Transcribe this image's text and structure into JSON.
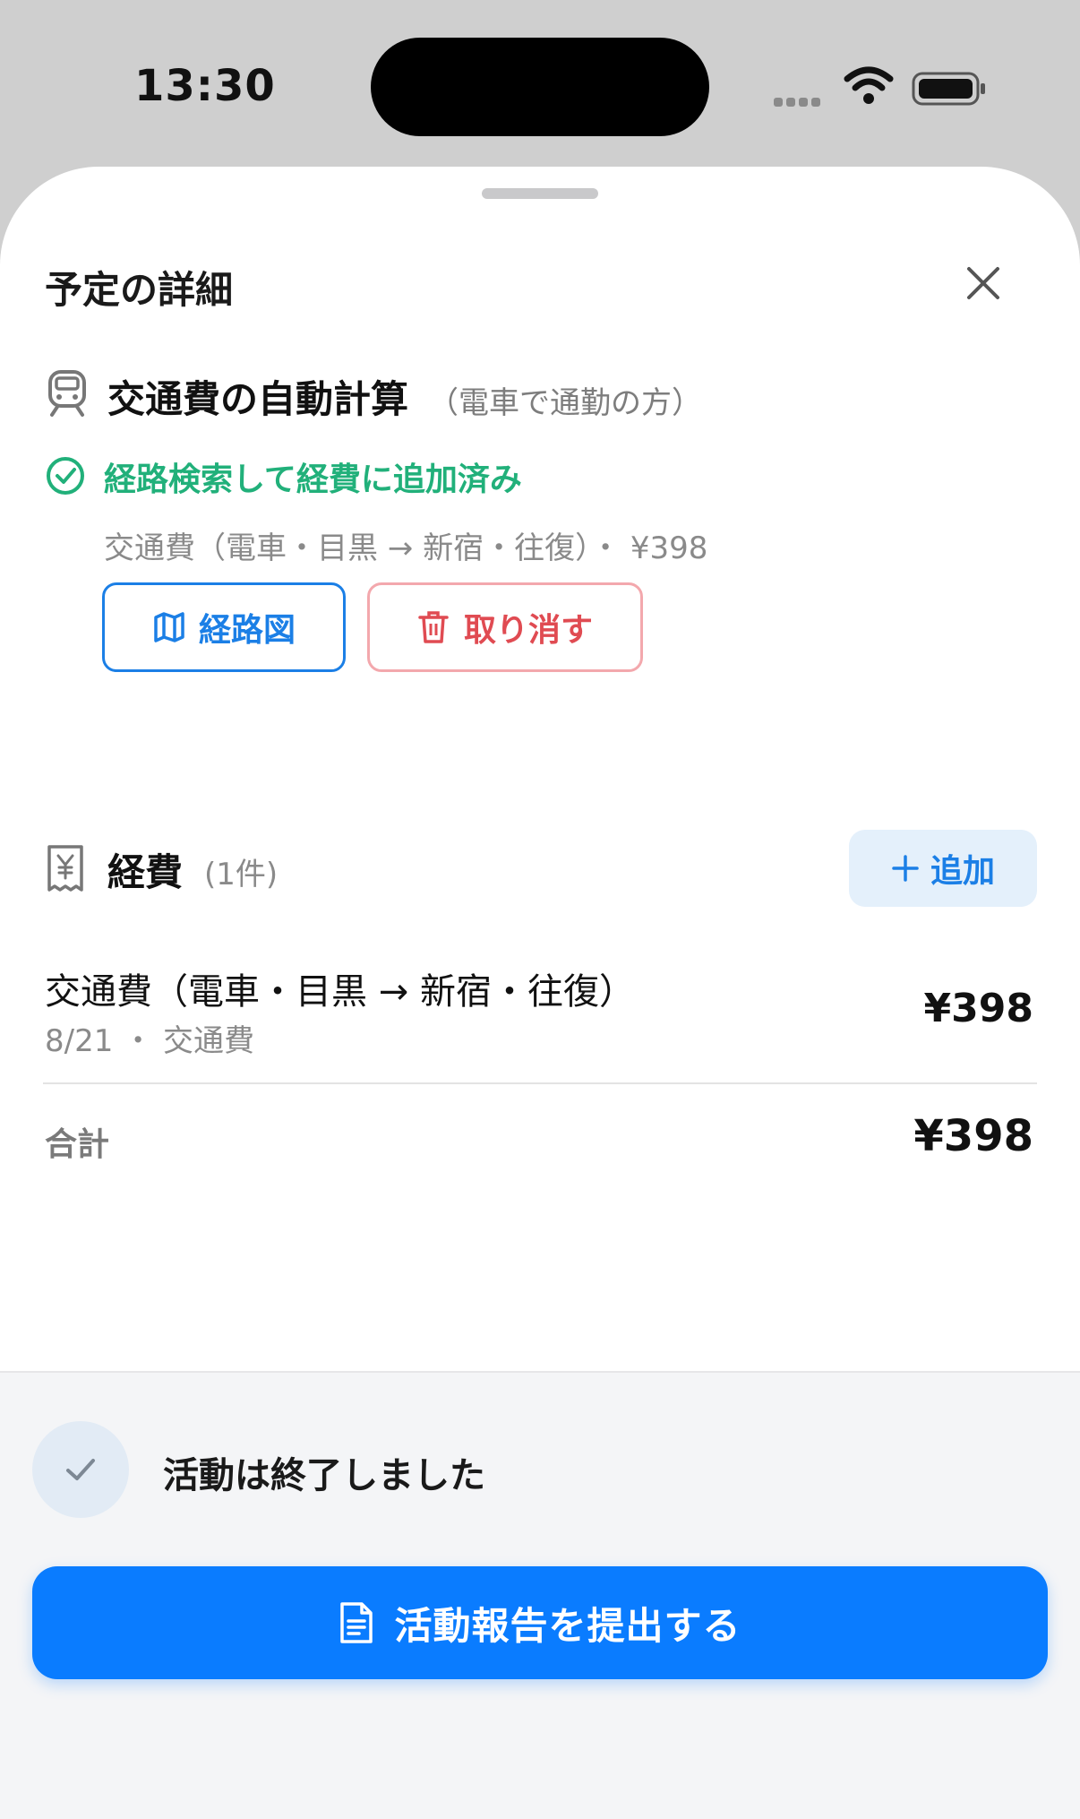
{
  "status_bar": {
    "time": "13:30"
  },
  "sheet": {
    "title": "予定の詳細"
  },
  "commute": {
    "title": "交通費の自動計算",
    "subtitle": "（電車で通勤の方）",
    "status": "経路検索して経費に追加済み",
    "summary": "交通費（電車・目黒 → 新宿・往復）・ ¥398",
    "route_map_label": "経路図",
    "cancel_label": "取り消す"
  },
  "expenses": {
    "title": "経費",
    "count": "(1件)",
    "add_label": "追加",
    "items": [
      {
        "title": "交通費（電車・目黒 → 新宿・往復）",
        "meta": "8/21 ・ 交通費",
        "amount": "¥398"
      }
    ],
    "total_label": "合計",
    "total_amount": "¥398"
  },
  "activity": {
    "done_label": "活動は終了しました",
    "submit_label": "活動報告を提出する"
  },
  "colors": {
    "accent": "#0a7cff",
    "success": "#21b07a",
    "danger": "#e04b52"
  },
  "icons": [
    "train-icon",
    "check-circle-icon",
    "map-icon",
    "trash-icon",
    "receipt-yen-icon",
    "plus-icon",
    "checkmark-icon",
    "document-icon",
    "close-icon"
  ]
}
